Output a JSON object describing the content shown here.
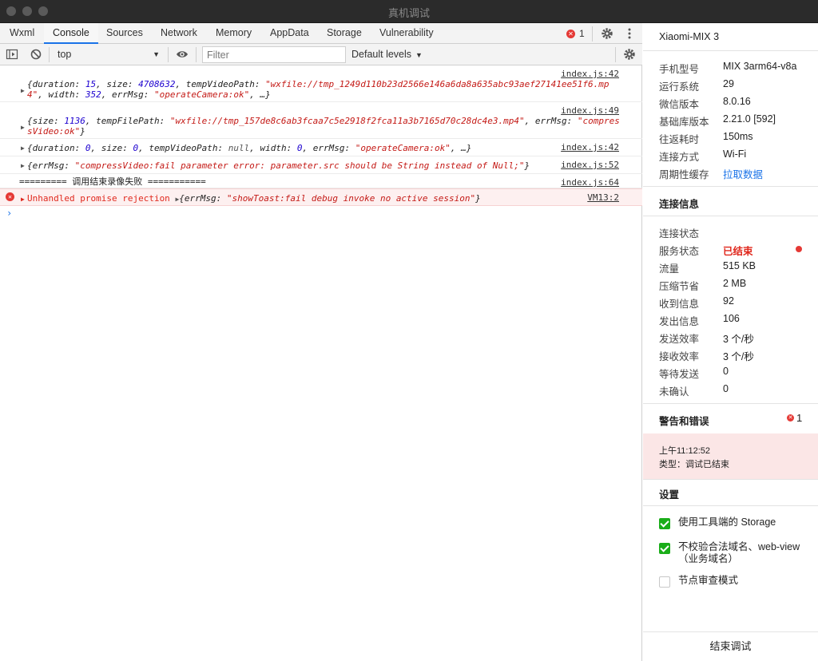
{
  "window": {
    "title": "真机调试"
  },
  "tabs": [
    {
      "label": "Wxml"
    },
    {
      "label": "Console"
    },
    {
      "label": "Sources"
    },
    {
      "label": "Network"
    },
    {
      "label": "Memory"
    },
    {
      "label": "AppData"
    },
    {
      "label": "Storage"
    },
    {
      "label": "Vulnerability"
    }
  ],
  "error_count": "1",
  "toolbar": {
    "context": "top",
    "filter_placeholder": "Filter",
    "levels": "Default levels"
  },
  "console": {
    "messages": [
      {
        "source": "index.js:42"
      },
      {
        "source": "index.js:49"
      },
      {
        "source": "index.js:42"
      },
      {
        "source": "index.js:52"
      },
      {
        "source": "index.js:64",
        "text": "========= 调用结束录像失败 ==========="
      },
      {
        "source": "VM13:2",
        "label": "Unhandled promise rejection"
      }
    ]
  },
  "device": {
    "name": "Xiaomi-MIX 3",
    "info": [
      {
        "label": "手机型号",
        "value": "MIX 3arm64-v8a"
      },
      {
        "label": "运行系统",
        "value": "29"
      },
      {
        "label": "微信版本",
        "value": "8.0.16"
      },
      {
        "label": "基础库版本",
        "value": "2.21.0 [592]"
      },
      {
        "label": "往返耗时",
        "value": "150ms"
      },
      {
        "label": "连接方式",
        "value": "Wi-Fi"
      },
      {
        "label": "周期性缓存",
        "value": "拉取数据"
      }
    ]
  },
  "connection": {
    "title": "连接信息",
    "rows": [
      {
        "label": "连接状态",
        "value": ""
      },
      {
        "label": "服务状态",
        "value": "已结束"
      },
      {
        "label": "流量",
        "value": "515 KB"
      },
      {
        "label": "压缩节省",
        "value": "2 MB"
      },
      {
        "label": "收到信息",
        "value": "92"
      },
      {
        "label": "发出信息",
        "value": "106"
      },
      {
        "label": "发送效率",
        "value": "3 个/秒"
      },
      {
        "label": "接收效率",
        "value": "3 个/秒"
      },
      {
        "label": "等待发送",
        "value": "0"
      },
      {
        "label": "未确认",
        "value": "0"
      }
    ]
  },
  "warnings": {
    "title": "警告和错误",
    "count": "1",
    "time": "上午11:12:52",
    "type": "类型：调试已结束"
  },
  "settings": {
    "title": "设置",
    "options": [
      {
        "label": "使用工具端的 Storage",
        "checked": true
      },
      {
        "label": "不校验合法域名、web-view（业务域名）",
        "checked": true
      },
      {
        "label": "节点审查模式",
        "checked": false
      }
    ]
  },
  "end_button": "结束调试",
  "colors": {
    "accent": "#1a73e8",
    "error": "#e53935",
    "check": "#1aad19"
  }
}
